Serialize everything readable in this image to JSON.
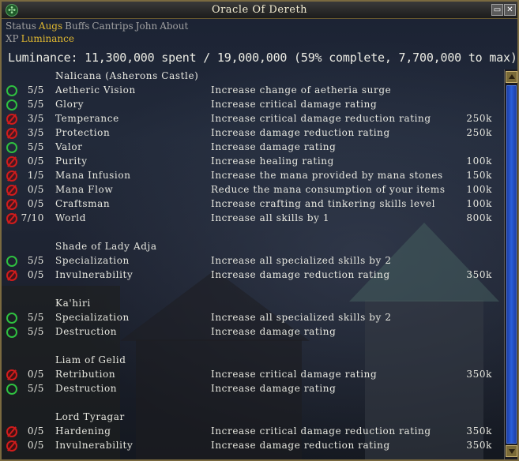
{
  "window": {
    "title": "Oracle Of Dereth"
  },
  "tabs_row1": [
    {
      "label": "Status",
      "active": false
    },
    {
      "label": "Augs",
      "active": true
    },
    {
      "label": "Buffs",
      "active": false
    },
    {
      "label": "Cantrips",
      "active": false
    },
    {
      "label": "John",
      "active": false
    },
    {
      "label": "About",
      "active": false
    }
  ],
  "tabs_row2": [
    {
      "label": "XP",
      "active": false
    },
    {
      "label": "Luminance",
      "active": true
    }
  ],
  "summary": "Luminance: 11,300,000 spent / 19,000,000 (59% complete, 7,700,000 to max)",
  "groups": [
    {
      "header": "Nalicana (Asherons Castle)",
      "rows": [
        {
          "status": "done",
          "count": "5/5",
          "name": "Aetheric Vision",
          "desc": "Increase change of aetheria surge",
          "cost": ""
        },
        {
          "status": "done",
          "count": "5/5",
          "name": "Glory",
          "desc": "Increase critical damage rating",
          "cost": ""
        },
        {
          "status": "todo",
          "count": "3/5",
          "name": "Temperance",
          "desc": "Increase critical damage reduction rating",
          "cost": "250k"
        },
        {
          "status": "todo",
          "count": "3/5",
          "name": "Protection",
          "desc": "Increase damage reduction rating",
          "cost": "250k"
        },
        {
          "status": "done",
          "count": "5/5",
          "name": "Valor",
          "desc": "Increase damage rating",
          "cost": ""
        },
        {
          "status": "todo",
          "count": "0/5",
          "name": "Purity",
          "desc": "Increase healing rating",
          "cost": "100k"
        },
        {
          "status": "todo",
          "count": "1/5",
          "name": "Mana Infusion",
          "desc": "Increase the mana provided by mana stones",
          "cost": "150k"
        },
        {
          "status": "todo",
          "count": "0/5",
          "name": "Mana Flow",
          "desc": "Reduce the mana consumption of your items",
          "cost": "100k"
        },
        {
          "status": "todo",
          "count": "0/5",
          "name": "Craftsman",
          "desc": "Increase crafting and tinkering skills level",
          "cost": "100k"
        },
        {
          "status": "todo",
          "count": "7/10",
          "name": "World",
          "desc": "Increase all skills by 1",
          "cost": "800k"
        }
      ]
    },
    {
      "header": "Shade of Lady Adja",
      "rows": [
        {
          "status": "done",
          "count": "5/5",
          "name": "Specialization",
          "desc": "Increase all specialized skills by 2",
          "cost": ""
        },
        {
          "status": "todo",
          "count": "0/5",
          "name": "Invulnerability",
          "desc": "Increase damage reduction rating",
          "cost": "350k"
        }
      ]
    },
    {
      "header": "Ka'hiri",
      "rows": [
        {
          "status": "done",
          "count": "5/5",
          "name": "Specialization",
          "desc": "Increase all specialized skills by 2",
          "cost": ""
        },
        {
          "status": "done",
          "count": "5/5",
          "name": "Destruction",
          "desc": "Increase damage rating",
          "cost": ""
        }
      ]
    },
    {
      "header": "Liam of Gelid",
      "rows": [
        {
          "status": "todo",
          "count": "0/5",
          "name": "Retribution",
          "desc": "Increase critical damage rating",
          "cost": "350k"
        },
        {
          "status": "done",
          "count": "5/5",
          "name": "Destruction",
          "desc": "Increase damage rating",
          "cost": ""
        }
      ]
    },
    {
      "header": "Lord Tyragar",
      "rows": [
        {
          "status": "todo",
          "count": "0/5",
          "name": "Hardening",
          "desc": "Increase critical damage reduction rating",
          "cost": "350k"
        },
        {
          "status": "todo",
          "count": "0/5",
          "name": "Invulnerability",
          "desc": "Increase damage reduction rating",
          "cost": "350k"
        }
      ]
    }
  ],
  "icons": {
    "done": "green-ring-icon",
    "todo": "red-no-entry-icon"
  },
  "colors": {
    "active_tab": "#e0b830",
    "done": "#2fc040",
    "todo": "#d01c1c",
    "scroll_thumb": "#2b5fd8"
  }
}
